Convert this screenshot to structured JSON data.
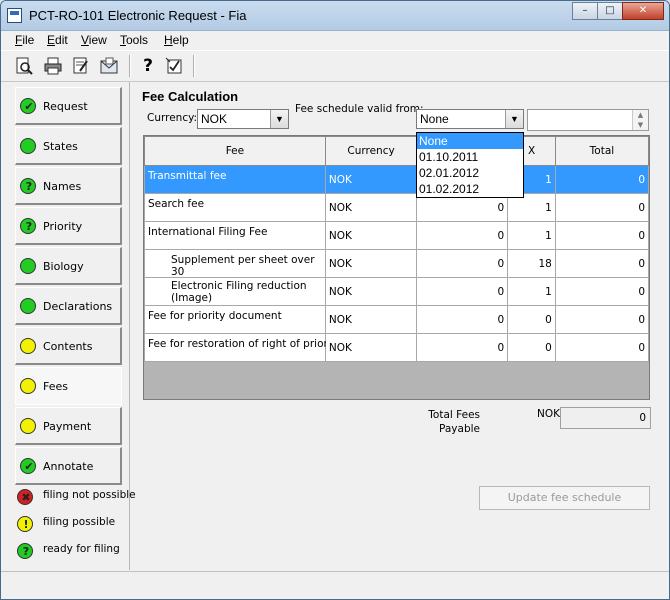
{
  "window": {
    "title": "PCT-RO-101 Electronic Request - Fia",
    "minimize": "–",
    "maximize": "□",
    "close": "✕"
  },
  "menu": {
    "file": {
      "accel": "F",
      "rest": "ile"
    },
    "edit": {
      "accel": "E",
      "rest": "dit"
    },
    "view": {
      "accel": "V",
      "rest": "iew"
    },
    "tools": {
      "accel": "T",
      "rest": "ools"
    },
    "help": {
      "accel": "H",
      "rest": "elp"
    }
  },
  "toolbar": {
    "icons": [
      "print-preview-icon",
      "print-icon",
      "validate-icon",
      "send-icon",
      "help-icon",
      "context-help-icon"
    ],
    "help_glyph": "?"
  },
  "sidebar": {
    "items": [
      {
        "label": "Request",
        "color": "#22cc22",
        "mark": "✔"
      },
      {
        "label": "States",
        "color": "#22cc22",
        "mark": ""
      },
      {
        "label": "Names",
        "color": "#22cc22",
        "mark": "?"
      },
      {
        "label": "Priority",
        "color": "#22cc22",
        "mark": "?"
      },
      {
        "label": "Biology",
        "color": "#22cc22",
        "mark": ""
      },
      {
        "label": "Declarations",
        "color": "#22cc22",
        "mark": ""
      },
      {
        "label": "Contents",
        "color": "#f2f200",
        "mark": ""
      },
      {
        "label": "Fees",
        "color": "#f2f200",
        "mark": ""
      },
      {
        "label": "Payment",
        "color": "#f2f200",
        "mark": ""
      },
      {
        "label": "Annotate",
        "color": "#22cc22",
        "mark": "✔"
      }
    ],
    "active_index": 7,
    "legend": [
      {
        "label": "filing not possible",
        "color": "#d42020",
        "mark": "✖"
      },
      {
        "label": "filing possible",
        "color": "#f2f200",
        "mark": "!"
      },
      {
        "label": "ready for filing",
        "color": "#22cc22",
        "mark": "?"
      }
    ]
  },
  "fee_calc": {
    "title": "Fee Calculation",
    "currency_label": "Currency:",
    "currency_value": "NOK",
    "schedule_label": "Fee schedule valid from:",
    "schedule_value": "None",
    "schedule_options": [
      "None",
      "01.10.2011",
      "02.01.2012",
      "01.02.2012"
    ],
    "schedule_highlighted": 0,
    "columns": [
      "Fee",
      "Currency",
      "",
      "X",
      "Total"
    ],
    "rows": [
      {
        "fee": "Transmittal fee",
        "currency": "NOK",
        "amount": "",
        "x": "1",
        "total": "0",
        "selected": true,
        "indent": false
      },
      {
        "fee": "Search fee",
        "currency": "NOK",
        "amount": "0",
        "x": "1",
        "total": "0",
        "selected": false,
        "indent": false
      },
      {
        "fee": "International Filing Fee",
        "currency": "NOK",
        "amount": "0",
        "x": "1",
        "total": "0",
        "selected": false,
        "indent": false
      },
      {
        "fee": "Supplement per sheet over 30",
        "currency": "NOK",
        "amount": "0",
        "x": "18",
        "total": "0",
        "selected": false,
        "indent": true
      },
      {
        "fee": "Electronic Filing reduction (Image)",
        "currency": "NOK",
        "amount": "0",
        "x": "1",
        "total": "0",
        "selected": false,
        "indent": true
      },
      {
        "fee": "Fee for priority document",
        "currency": "NOK",
        "amount": "0",
        "x": "0",
        "total": "0",
        "selected": false,
        "indent": false
      },
      {
        "fee": "Fee for restoration of right of priority",
        "currency": "NOK",
        "amount": "0",
        "x": "0",
        "total": "0",
        "selected": false,
        "indent": false
      }
    ],
    "total_label_1": "Total Fees",
    "total_label_2": "Payable",
    "total_currency": "NOK",
    "total_value": "0",
    "update_button": "Update fee schedule"
  }
}
